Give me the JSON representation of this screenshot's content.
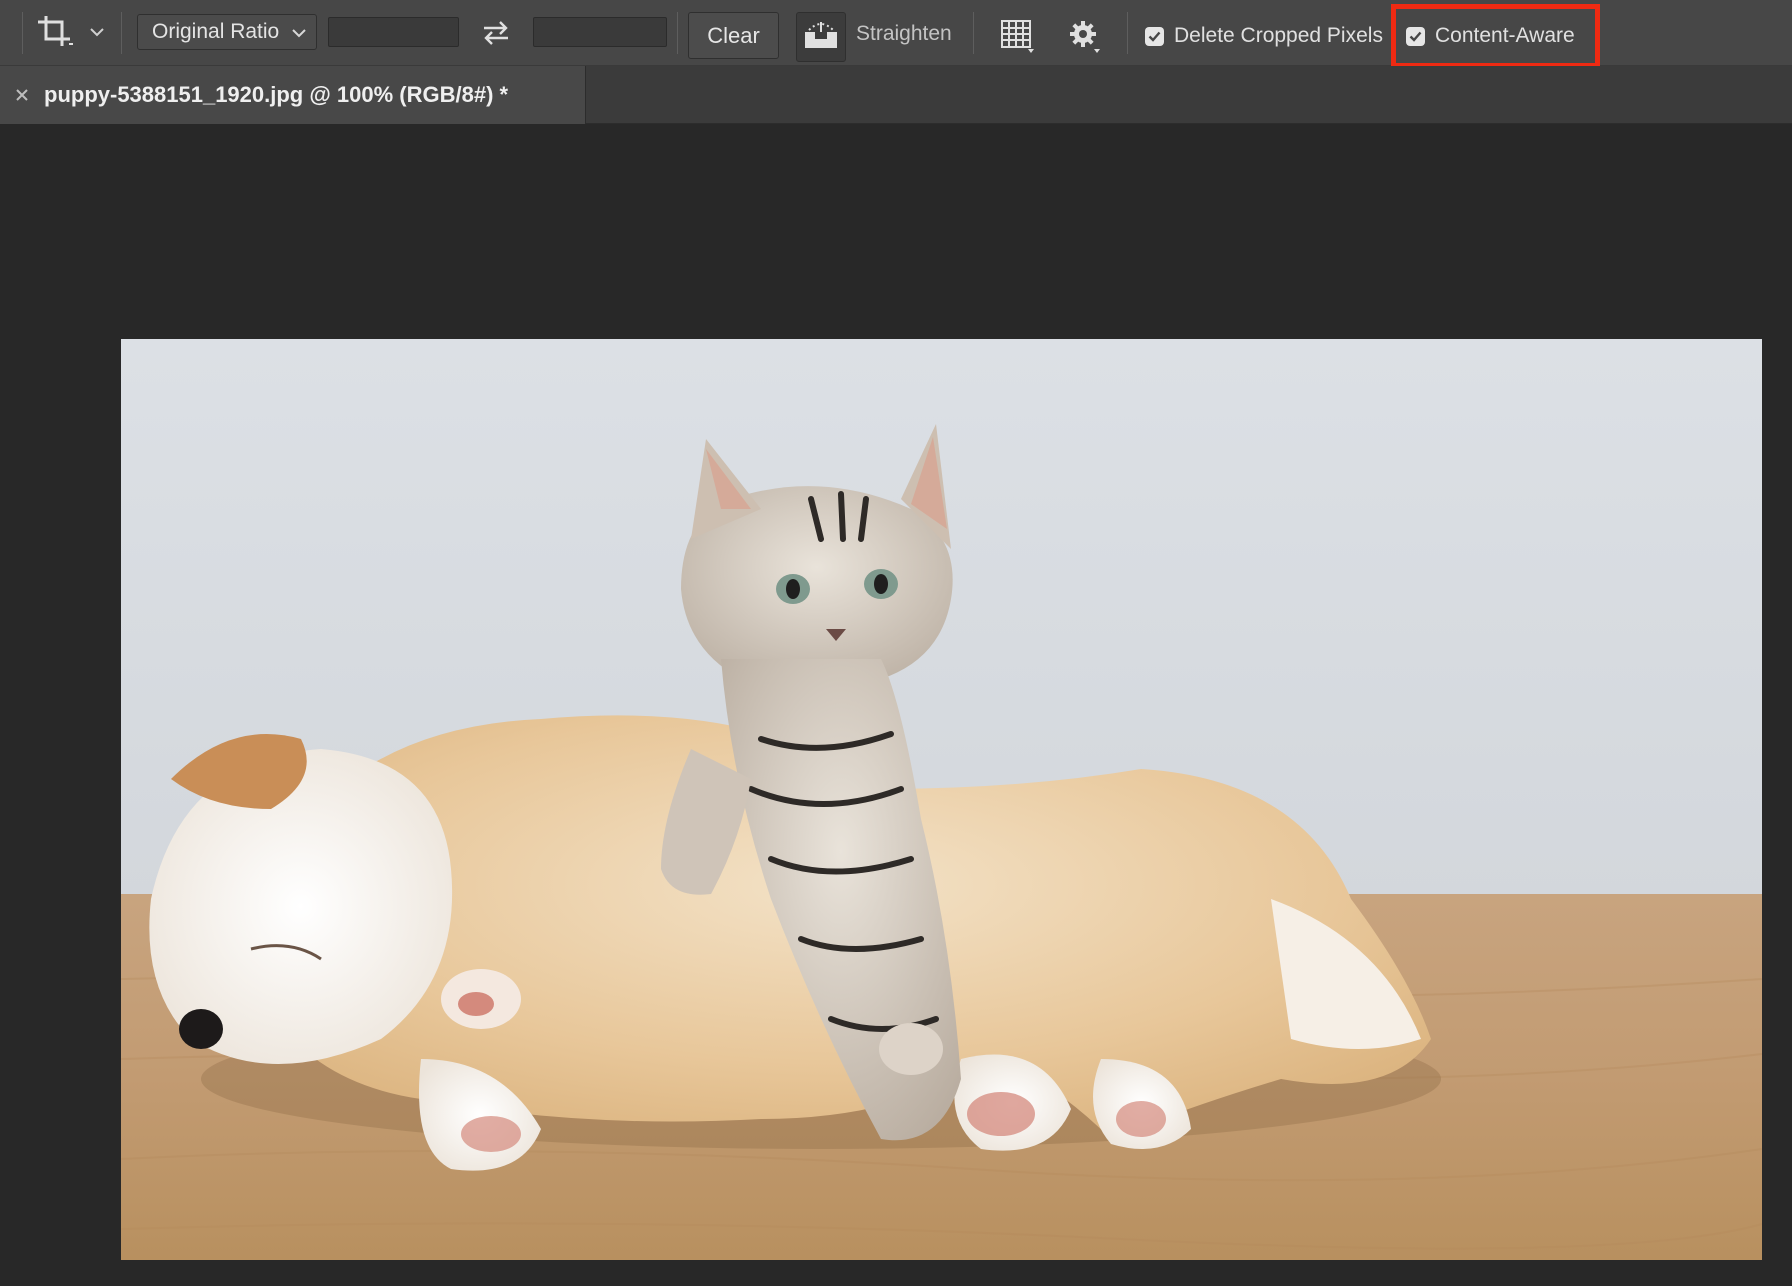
{
  "toolbar": {
    "crop_tool_icon": "crop-icon",
    "ratio_dropdown": {
      "selected": "Original Ratio"
    },
    "width_field": {
      "value": ""
    },
    "height_field": {
      "value": ""
    },
    "swap_icon": "swap-arrows-icon",
    "clear_label": "Clear",
    "straighten_label": "Straighten",
    "grid_icon": "grid-overlay-icon",
    "gear_icon": "gear-icon",
    "delete_cropped_pixels": {
      "label": "Delete Cropped Pixels",
      "checked": true
    },
    "content_aware": {
      "label": "Content-Aware",
      "checked": true,
      "highlight_color": "#ef2a12"
    }
  },
  "document_tab": {
    "title": "puppy-5388151_1920.jpg @ 100% (RGB/8#) *",
    "close_icon": "close-icon"
  },
  "canvas": {
    "background": "#282828",
    "image_subject": "kitten-and-sleeping-puppy-photo"
  }
}
